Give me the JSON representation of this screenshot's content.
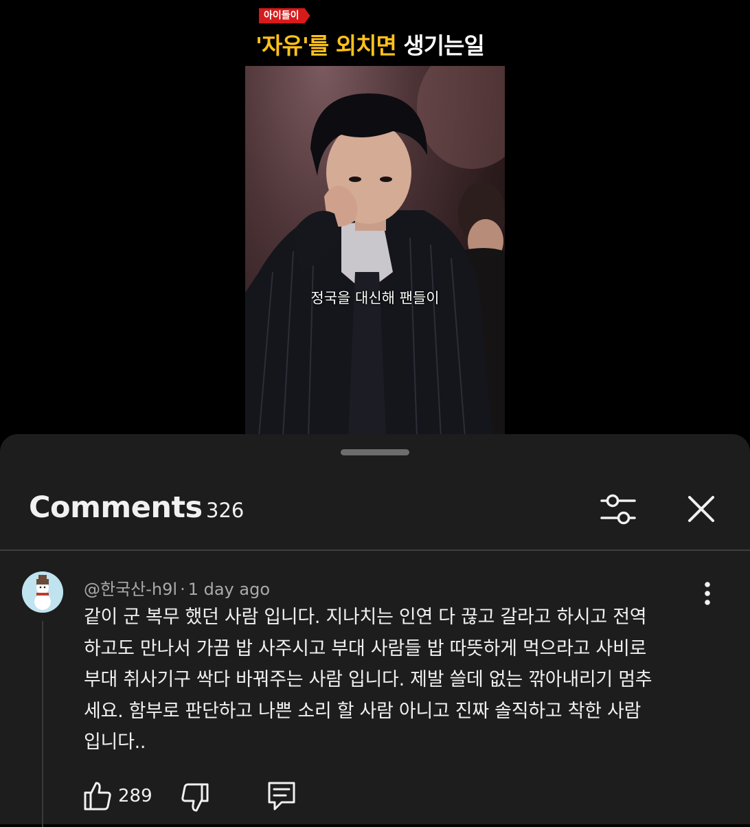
{
  "video": {
    "tag": "아이돌이",
    "title_part1": "'자유'를 외치면",
    "title_part2": "생기는일",
    "subtitle": "정국을 대신해 팬들이"
  },
  "comments_panel": {
    "title": "Comments",
    "count": "326",
    "filter_icon": "sliders-icon",
    "close_icon": "close-icon"
  },
  "comment": {
    "author": "@한국산-h9l",
    "time": "1 day ago",
    "lines": [
      "같이 군 복무 했던 사람 입니다. 지나치는 인연 다 끊고 갈라고 하시고 전역",
      "하고도 만나서 가끔 밥 사주시고 부대 사람들 밥 따뜻하게 먹으라고 사비로",
      "부대 취사기구 싹다 바꿔주는 사람 입니다. 제발 쓸데 없는 깎아내리기 멈추",
      "세요. 함부로 판단하고 나쁜 소리 할 사람 아니고 진짜 솔직하고 착한 사람",
      "입니다.."
    ],
    "likes": "289",
    "icons": {
      "like": "thumbs-up-icon",
      "dislike": "thumbs-down-icon",
      "reply": "reply-icon",
      "more": "more-vertical-icon"
    }
  }
}
